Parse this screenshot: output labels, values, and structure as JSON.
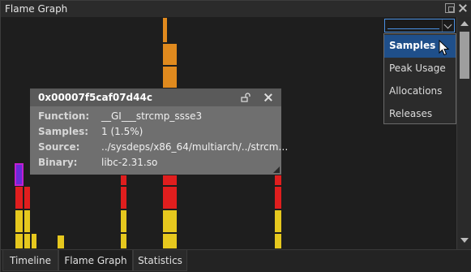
{
  "window": {
    "title": "Flame Graph"
  },
  "cost_selector": {
    "current": "",
    "options": [
      "Samples",
      "Peak Usage",
      "Allocations",
      "Releases"
    ],
    "highlighted": "Samples"
  },
  "tooltip": {
    "address": "0x00007f5caf07d44c",
    "rows": [
      {
        "label": "Function:",
        "value": "__GI___strcmp_ssse3"
      },
      {
        "label": "Samples:",
        "value": "1 (1.5%)"
      },
      {
        "label": "Source:",
        "value": "../sysdeps/x86_64/multiarch/../strcm…"
      },
      {
        "label": "Binary:",
        "value": "libc-2.31.so"
      }
    ]
  },
  "tabs": [
    {
      "label": "Timeline",
      "active": false
    },
    {
      "label": "Flame Graph",
      "active": true
    },
    {
      "label": "Statistics",
      "active": false
    }
  ],
  "colors": {
    "frame_yellow": "#e6c81e",
    "frame_red": "#e01e1e",
    "frame_orange": "#e08a1e",
    "frame_selected": "#6a2bd8",
    "selection_blue": "#1f4f8a"
  }
}
